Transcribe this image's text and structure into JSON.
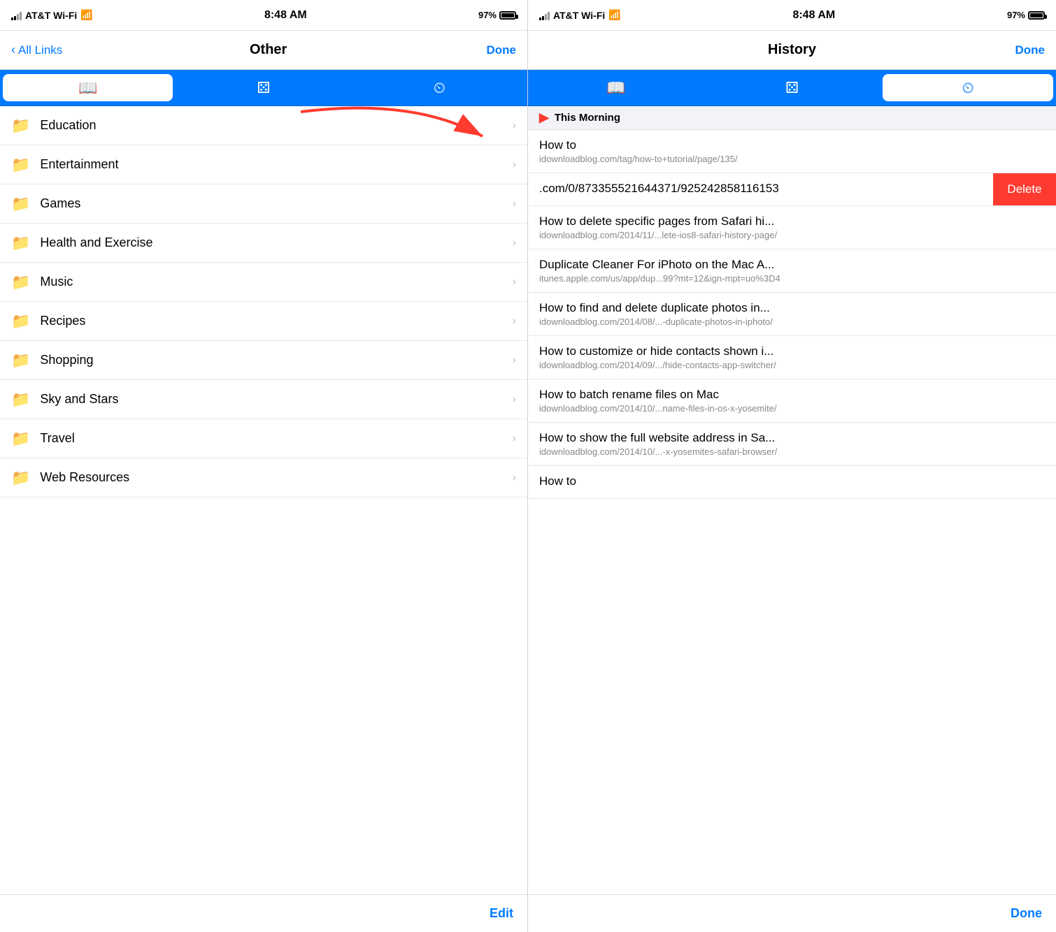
{
  "left": {
    "status": {
      "carrier": "AT&T Wi-Fi",
      "time": "8:48 AM",
      "battery": "97%"
    },
    "nav": {
      "back_label": "All Links",
      "title": "Other",
      "action": "Done"
    },
    "tabs": [
      {
        "id": "bookmarks",
        "icon": "📖",
        "active": true
      },
      {
        "id": "reading",
        "icon": "👓",
        "active": false
      },
      {
        "id": "history",
        "icon": "🕐",
        "active": false
      }
    ],
    "items": [
      {
        "label": "Education"
      },
      {
        "label": "Entertainment"
      },
      {
        "label": "Games"
      },
      {
        "label": "Health and Exercise"
      },
      {
        "label": "Music"
      },
      {
        "label": "Recipes"
      },
      {
        "label": "Shopping"
      },
      {
        "label": "Sky and Stars"
      },
      {
        "label": "Travel"
      },
      {
        "label": "Web Resources"
      }
    ],
    "bottom_action": "Edit"
  },
  "right": {
    "status": {
      "carrier": "AT&T Wi-Fi",
      "time": "8:48 AM",
      "battery": "97%"
    },
    "nav": {
      "title": "History",
      "action": "Done"
    },
    "tabs": [
      {
        "id": "bookmarks",
        "icon": "📖",
        "active": false
      },
      {
        "id": "reading",
        "icon": "👓",
        "active": false
      },
      {
        "id": "history",
        "icon": "🕐",
        "active": true
      }
    ],
    "section": "This Morning",
    "history_items": [
      {
        "title": "How to",
        "url": "idownloadblog.com/tag/how-to+tutorial/page/135/",
        "swiped": false
      },
      {
        "title": ".com/0/873355521644371/925242858116153",
        "url": "",
        "swiped": true,
        "delete_label": "Delete"
      },
      {
        "title": "How to delete specific pages from Safari hi...",
        "url": "idownloadblog.com/2014/11/...lete-ios8-safari-history-page/",
        "swiped": false
      },
      {
        "title": "Duplicate Cleaner For iPhoto on the Mac A...",
        "url": "itunes.apple.com/us/app/dup...99?mt=12&ign-mpt=uo%3D4",
        "swiped": false
      },
      {
        "title": "How to find and delete duplicate photos in...",
        "url": "idownloadblog.com/2014/08/...-duplicate-photos-in-iphoto/",
        "swiped": false
      },
      {
        "title": "How to customize or hide contacts shown i...",
        "url": "idownloadblog.com/2014/09/.../hide-contacts-app-switcher/",
        "swiped": false
      },
      {
        "title": "How to batch rename files on Mac",
        "url": "idownloadblog.com/2014/10/...name-files-in-os-x-yosemite/",
        "swiped": false
      },
      {
        "title": "How to show the full website address in Sa...",
        "url": "idownloadblog.com/2014/10/...-x-yosemites-safari-browser/",
        "swiped": false
      },
      {
        "title": "How to",
        "url": "",
        "swiped": false
      }
    ],
    "bottom_action": "Done"
  }
}
